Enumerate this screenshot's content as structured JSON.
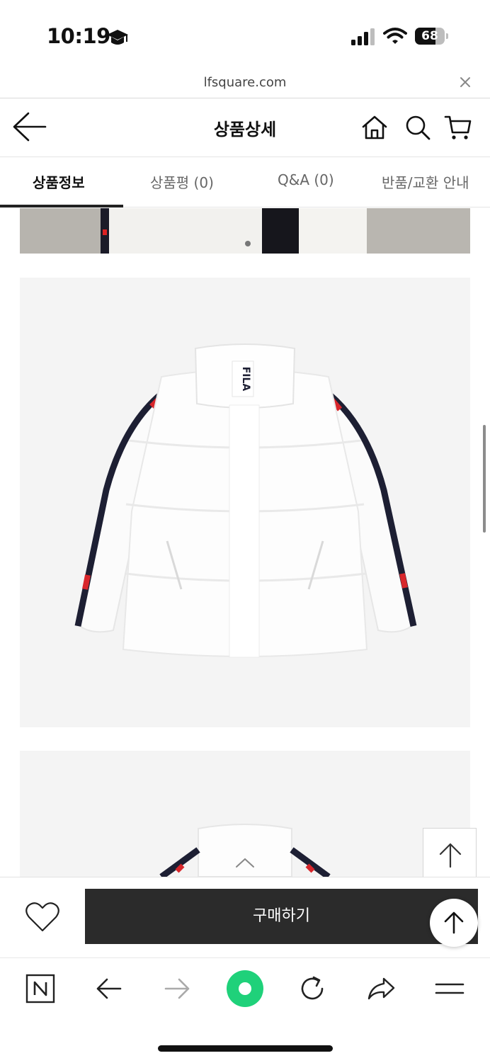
{
  "status_bar": {
    "time": "10:19",
    "battery": "68",
    "battery_level_percent": 68
  },
  "browser": {
    "url": "lfsquare.com"
  },
  "header": {
    "title": "상품상세"
  },
  "tabs": [
    {
      "label": "상품정보",
      "active": true
    },
    {
      "label": "상품평 (0)",
      "active": false
    },
    {
      "label": "Q&A (0)",
      "active": false
    },
    {
      "label": "반품/교환 안내",
      "active": false
    }
  ],
  "product": {
    "brand_logo": "FILA"
  },
  "actions": {
    "buy_label": "구매하기"
  },
  "colors": {
    "buy_button": "#2b2b2b",
    "naver_green": "#1fd17a",
    "image_bg": "#f4f4f4"
  }
}
